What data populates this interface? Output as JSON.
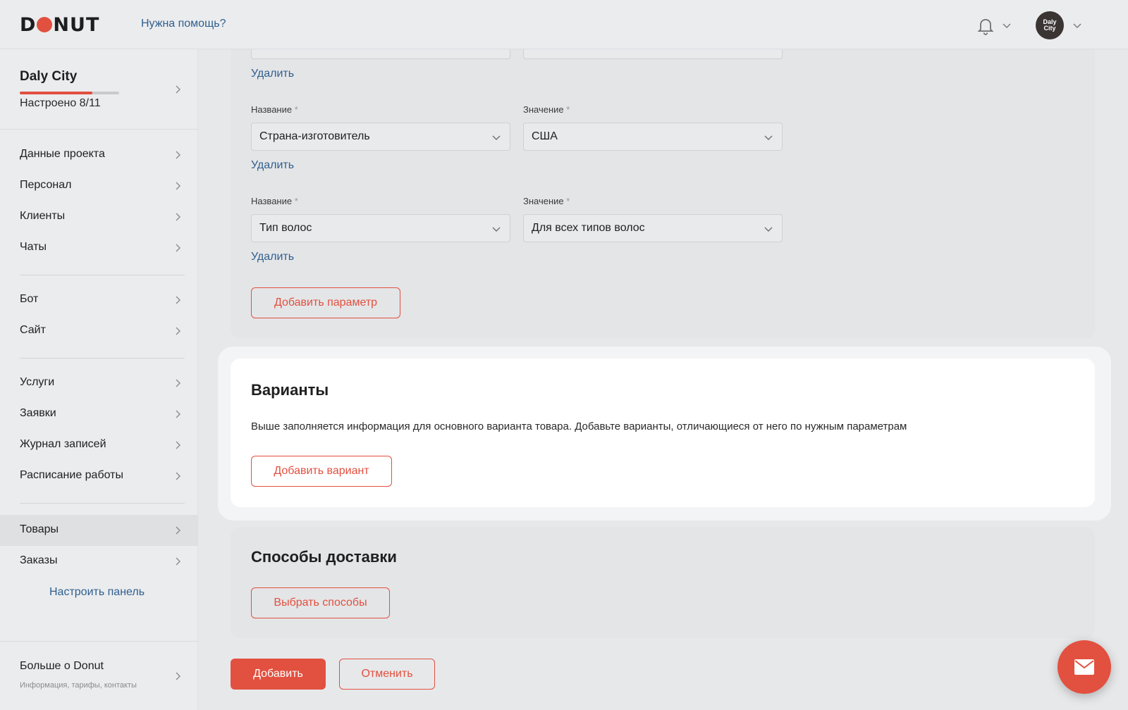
{
  "header": {
    "logo": "DONUT",
    "help_link": "Нужна помощь?",
    "avatar_text_1": "Daly",
    "avatar_text_2": "City"
  },
  "sidebar": {
    "project_name": "Daly City",
    "project_status": "Настроено 8/11",
    "setup_progress": 0.727,
    "items": [
      {
        "label": "Данные проекта"
      },
      {
        "label": "Персонал"
      },
      {
        "label": "Клиенты"
      },
      {
        "label": "Чаты"
      },
      {
        "label": "Бот"
      },
      {
        "label": "Сайт"
      },
      {
        "label": "Услуги"
      },
      {
        "label": "Заявки"
      },
      {
        "label": "Журнал записей"
      },
      {
        "label": "Расписание работы"
      },
      {
        "label": "Товары"
      },
      {
        "label": "Заказы"
      }
    ],
    "active_item": "Товары",
    "setup_panel_link": "Настроить панель",
    "more_title": "Больше о Donut",
    "more_subtitle": "Информация, тарифы, контакты"
  },
  "params": {
    "delete_label": "Удалить",
    "rows": [
      {
        "name_label": "Название",
        "value_label": "Значение",
        "name": "Страна-изготовитель",
        "value": "США"
      },
      {
        "name_label": "Название",
        "value_label": "Значение",
        "name": "Тип волос",
        "value": "Для всех типов волос"
      }
    ],
    "required_mark": "*",
    "add_param_button": "Добавить параметр"
  },
  "variants": {
    "title": "Варианты",
    "description": "Выше заполняется информация для основного варианта товара. Добавьте варианты, отличающиеся от него по нужным параметрам",
    "add_variant_button": "Добавить вариант"
  },
  "delivery": {
    "title": "Способы доставки",
    "choose_button": "Выбрать способы"
  },
  "actions": {
    "submit_button": "Добавить",
    "cancel_button": "Отменить"
  },
  "colors": {
    "accent": "#e2503f",
    "link": "#2f5f8f"
  },
  "icons": {
    "fab": "mail-icon",
    "notifications": "bell-icon"
  }
}
